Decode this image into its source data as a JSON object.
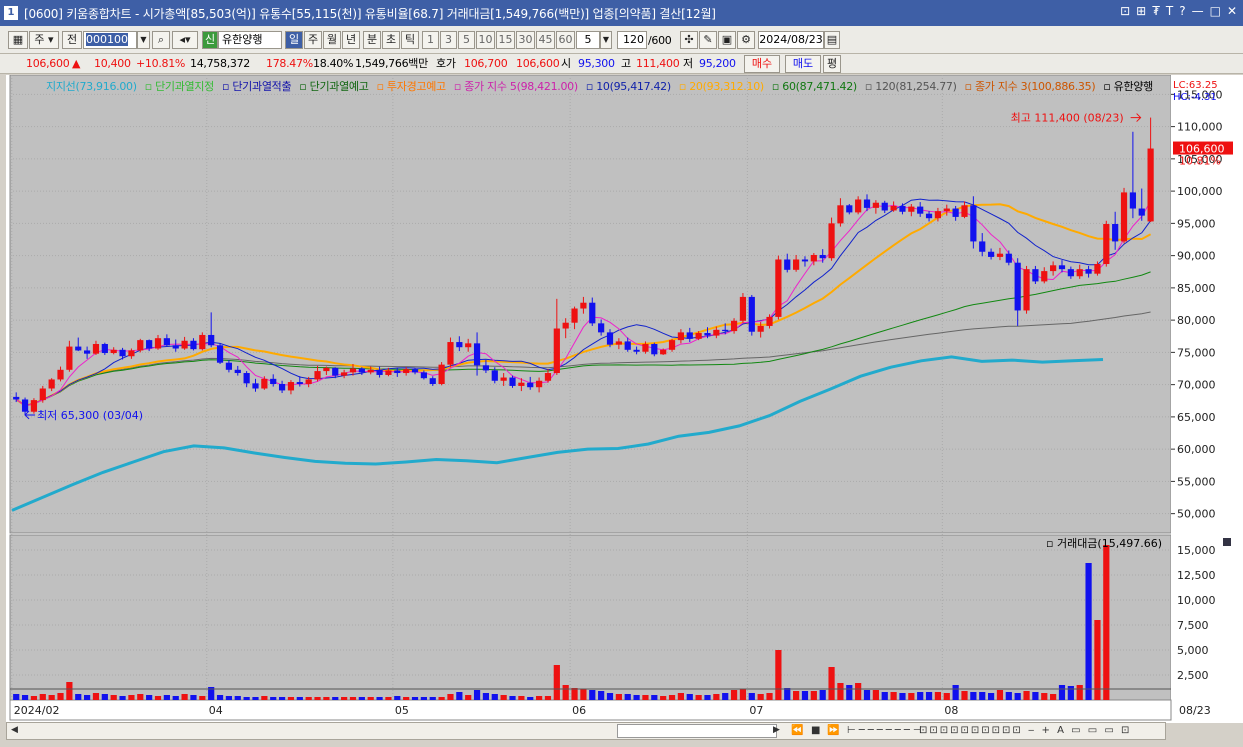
{
  "window": {
    "number": "1",
    "title": "[0600] 키움종합차트 - 시가총액[85,503(억)] 유통수[55,115(천)] 유통비율[68.7] 거래대금[1,549,766(백만)] 업종[의약품] 결산[12월]",
    "controls": [
      "⊡",
      "⊞",
      "₮",
      "T",
      "?",
      "—",
      "□",
      "✕"
    ]
  },
  "toolbar": {
    "period_unit": "주",
    "scope": "전",
    "code": "000100",
    "name_tag": "신",
    "stock_name": "유한양행",
    "intervals": [
      "일",
      "주",
      "월",
      "년",
      "분",
      "초",
      "틱"
    ],
    "selected_interval": "일",
    "minute_options": [
      "1",
      "3",
      "5",
      "10",
      "15",
      "30",
      "45",
      "60"
    ],
    "custom_interval": "5",
    "bars": "120",
    "bars_total": "/600",
    "date": "2024/08/23"
  },
  "quote": {
    "price": "106,600",
    "change": "10,400",
    "pct": "+10.81%",
    "volume": "14,758,372",
    "vol_ratio": "178.47%",
    "turnover": "18.40%",
    "amount": "1,549,766백만",
    "bid_label": "호가",
    "ask": "106,700",
    "bid": "106,600",
    "open_label": "시",
    "open": "95,300",
    "high_label": "고",
    "high": "111,400",
    "low_label": "저",
    "low": "95,200",
    "buy": "매수",
    "sell": "매도",
    "eval": "평"
  },
  "legend": [
    {
      "text": "지지선(73,916.00)",
      "color": "#22aacc"
    },
    {
      "text": "단기과열지정",
      "color": "#33bb33"
    },
    {
      "text": "단기과열적출",
      "color": "#1111aa"
    },
    {
      "text": "단기과열예고",
      "color": "#116611"
    },
    {
      "text": "투자경고예고",
      "color": "#ff7700"
    },
    {
      "text": "종가 지수 5(98,421.00)",
      "color": "#cc22aa"
    },
    {
      "text": "10(95,417.42)",
      "color": "#1122aa"
    },
    {
      "text": "20(93,312.10)",
      "color": "#ffaa00"
    },
    {
      "text": "60(87,471.42)",
      "color": "#117711"
    },
    {
      "text": "120(81,254.77)",
      "color": "#555555"
    },
    {
      "text": "종가 지수 3(100,886.35)",
      "color": "#cc5500"
    },
    {
      "text": "유한양행",
      "color": "#000000"
    }
  ],
  "right_labels": {
    "lc": "LC:63.25",
    "hc": "HC:-4.31",
    "current": "106,600",
    "pct": "10.81%"
  },
  "annotations": {
    "high": "최고 111,400 (08/23)",
    "low": "최저 65,300 (03/04)"
  },
  "volume_panel": {
    "title": "거래대금(15,497.66)"
  },
  "x_date_labels": [
    "2024/02",
    "04",
    "05",
    "06",
    "07",
    "08"
  ],
  "x_end_label": "08/23",
  "colors": {
    "up": "#ee1111",
    "down": "#1111ee",
    "ma5": "#ee22cc",
    "ma10": "#1122cc",
    "ma20": "#ffaa00",
    "ma60": "#118811",
    "ma120": "#666666",
    "support": "#22aacc",
    "bg": "#c0c0c0"
  },
  "chart_data": {
    "type": "candlestick",
    "ylim": [
      47000,
      118000
    ],
    "y_ticks": [
      115000,
      110000,
      105000,
      100000,
      95000,
      90000,
      85000,
      80000,
      75000,
      70000,
      65000,
      60000,
      55000,
      50000
    ],
    "y_tick_labels": [
      "115,000",
      "110,000",
      "105,000",
      "100,000",
      "95,000",
      "90,000",
      "85,000",
      "80,000",
      "75,000",
      "70,000",
      "65,000",
      "60,000",
      "55,000",
      "50,000"
    ],
    "x_ticks": [
      {
        "label": "2024/02",
        "index": 0
      },
      {
        "label": "04",
        "index": 22
      },
      {
        "label": "05",
        "index": 43
      },
      {
        "label": "06",
        "index": 63
      },
      {
        "label": "07",
        "index": 83
      },
      {
        "label": "08",
        "index": 105
      }
    ],
    "candles": [
      [
        68100,
        68800,
        67300,
        67700
      ],
      [
        67700,
        68000,
        65300,
        65800
      ],
      [
        65800,
        67900,
        65500,
        67600
      ],
      [
        67600,
        69800,
        67200,
        69400
      ],
      [
        69400,
        71000,
        69000,
        70800
      ],
      [
        70800,
        72800,
        70500,
        72300
      ],
      [
        72300,
        76800,
        72000,
        75900
      ],
      [
        75900,
        77300,
        75200,
        75300
      ],
      [
        75300,
        75900,
        74000,
        74800
      ],
      [
        74800,
        76800,
        74600,
        76300
      ],
      [
        76300,
        76500,
        74600,
        74900
      ],
      [
        74900,
        75800,
        74700,
        75400
      ],
      [
        75400,
        75700,
        73900,
        74400
      ],
      [
        74400,
        75600,
        74000,
        75300
      ],
      [
        75300,
        77100,
        75000,
        76900
      ],
      [
        76900,
        77000,
        75200,
        75600
      ],
      [
        75600,
        77700,
        75400,
        77200
      ],
      [
        77200,
        77800,
        75900,
        76100
      ],
      [
        76100,
        77000,
        75100,
        75600
      ],
      [
        75600,
        77400,
        75400,
        76800
      ],
      [
        76800,
        77200,
        75300,
        75500
      ],
      [
        75500,
        78100,
        75300,
        77700
      ],
      [
        77700,
        81200,
        75800,
        76100
      ],
      [
        76100,
        76400,
        73200,
        73400
      ],
      [
        73400,
        73800,
        71900,
        72300
      ],
      [
        72300,
        72900,
        71400,
        71800
      ],
      [
        71800,
        72100,
        69600,
        70200
      ],
      [
        70200,
        70900,
        68900,
        69400
      ],
      [
        69400,
        71300,
        69200,
        70900
      ],
      [
        70900,
        71600,
        69700,
        70100
      ],
      [
        70100,
        70600,
        68700,
        69100
      ],
      [
        69100,
        70700,
        68500,
        70400
      ],
      [
        70400,
        71300,
        69700,
        70100
      ],
      [
        70100,
        71200,
        69600,
        70800
      ],
      [
        70800,
        72900,
        70500,
        72100
      ],
      [
        72100,
        72800,
        71500,
        72600
      ],
      [
        72600,
        72700,
        71000,
        71400
      ],
      [
        71400,
        72300,
        71000,
        71900
      ],
      [
        71900,
        73200,
        71400,
        72500
      ],
      [
        72500,
        72700,
        71500,
        71900
      ],
      [
        71900,
        72800,
        71600,
        72300
      ],
      [
        72300,
        72800,
        71100,
        71500
      ],
      [
        71500,
        72600,
        71300,
        72200
      ],
      [
        72200,
        72500,
        71200,
        71800
      ],
      [
        71800,
        72700,
        71400,
        72400
      ],
      [
        72400,
        72600,
        71600,
        71900
      ],
      [
        71900,
        72200,
        70800,
        71000
      ],
      [
        71000,
        71300,
        69800,
        70100
      ],
      [
        70100,
        73500,
        69900,
        73100
      ],
      [
        73100,
        77300,
        72700,
        76600
      ],
      [
        76600,
        77500,
        75200,
        75800
      ],
      [
        75800,
        77100,
        75100,
        76400
      ],
      [
        76400,
        78100,
        71400,
        73000
      ],
      [
        73000,
        73800,
        71800,
        72200
      ],
      [
        72200,
        72700,
        70200,
        70600
      ],
      [
        70600,
        71800,
        69800,
        71100
      ],
      [
        71100,
        71400,
        69500,
        69800
      ],
      [
        69800,
        71000,
        69000,
        70300
      ],
      [
        70300,
        71200,
        69200,
        69600
      ],
      [
        69600,
        71100,
        68800,
        70600
      ],
      [
        70600,
        72400,
        70300,
        71800
      ],
      [
        71800,
        83300,
        71500,
        78700
      ],
      [
        78700,
        80300,
        77200,
        79600
      ],
      [
        79600,
        82100,
        78600,
        81800
      ],
      [
        81800,
        83600,
        81000,
        82700
      ],
      [
        82700,
        83500,
        79100,
        79500
      ],
      [
        79500,
        80100,
        77600,
        78100
      ],
      [
        78100,
        78600,
        75800,
        76200
      ],
      [
        76200,
        77200,
        75500,
        76700
      ],
      [
        76700,
        77300,
        75100,
        75400
      ],
      [
        75400,
        75900,
        74700,
        75100
      ],
      [
        75100,
        76700,
        74800,
        76300
      ],
      [
        76300,
        76500,
        74400,
        74700
      ],
      [
        74700,
        75600,
        74600,
        75400
      ],
      [
        75400,
        77100,
        75100,
        76900
      ],
      [
        76900,
        78600,
        76400,
        78100
      ],
      [
        78100,
        78800,
        76600,
        77100
      ],
      [
        77100,
        78300,
        76900,
        78000
      ],
      [
        78000,
        78900,
        77200,
        77600
      ],
      [
        77600,
        79000,
        77200,
        78500
      ],
      [
        78500,
        79500,
        77800,
        78300
      ],
      [
        78300,
        80300,
        77900,
        79900
      ],
      [
        79900,
        84200,
        79600,
        83600
      ],
      [
        83600,
        83900,
        77600,
        78200
      ],
      [
        78200,
        79700,
        77300,
        79100
      ],
      [
        79100,
        80900,
        78700,
        80500
      ],
      [
        80500,
        90000,
        80100,
        89400
      ],
      [
        89400,
        90300,
        87400,
        87800
      ],
      [
        87800,
        90100,
        87500,
        89400
      ],
      [
        89400,
        89900,
        88300,
        89100
      ],
      [
        89100,
        90400,
        88500,
        90100
      ],
      [
        90100,
        91000,
        88900,
        89600
      ],
      [
        89600,
        95900,
        89200,
        95000
      ],
      [
        95000,
        98900,
        94500,
        97800
      ],
      [
        97800,
        98000,
        96400,
        96700
      ],
      [
        96700,
        99200,
        96400,
        98700
      ],
      [
        98700,
        99500,
        96900,
        97400
      ],
      [
        97400,
        98600,
        96500,
        98200
      ],
      [
        98200,
        98500,
        96600,
        97000
      ],
      [
        97000,
        98400,
        96800,
        97700
      ],
      [
        97700,
        98100,
        96400,
        96800
      ],
      [
        96800,
        98000,
        96100,
        97600
      ],
      [
        97600,
        98300,
        96000,
        96500
      ],
      [
        96500,
        96900,
        95300,
        95800
      ],
      [
        95800,
        97400,
        95300,
        96900
      ],
      [
        96900,
        97900,
        96200,
        97300
      ],
      [
        97300,
        97700,
        95400,
        96000
      ],
      [
        96000,
        98400,
        95800,
        97800
      ],
      [
        97800,
        99200,
        91100,
        92200
      ],
      [
        92200,
        93500,
        89900,
        90600
      ],
      [
        90600,
        91100,
        89400,
        89800
      ],
      [
        89800,
        91200,
        89300,
        90300
      ],
      [
        90300,
        90800,
        88500,
        88900
      ],
      [
        88900,
        89600,
        79100,
        81500
      ],
      [
        81500,
        88400,
        81000,
        87900
      ],
      [
        87900,
        88400,
        85600,
        86000
      ],
      [
        86000,
        88200,
        85700,
        87600
      ],
      [
        87600,
        89100,
        86900,
        88500
      ],
      [
        88500,
        89300,
        87400,
        87900
      ],
      [
        87900,
        88300,
        86400,
        86800
      ],
      [
        86800,
        88600,
        86400,
        87900
      ],
      [
        87900,
        88400,
        86600,
        87200
      ],
      [
        87200,
        89100,
        86900,
        88700
      ],
      [
        88700,
        95400,
        88300,
        94900
      ],
      [
        94900,
        96800,
        90900,
        92200
      ],
      [
        92200,
        100500,
        91900,
        99800
      ],
      [
        99800,
        109200,
        95800,
        97300
      ],
      [
        97300,
        100400,
        95400,
        96200
      ],
      [
        95300,
        111400,
        95200,
        106600
      ]
    ],
    "ma5_last": 98421.0,
    "ma10_last": 95417.42,
    "ma20_last": 93312.1,
    "ma60_last": 87471.42,
    "ma120_last": 81254.77,
    "support_line": [
      50500,
      52500,
      54500,
      56400,
      58000,
      59600,
      60500,
      60200,
      59400,
      58700,
      58100,
      57800,
      57700,
      58000,
      58400,
      58200,
      57900,
      58700,
      59500,
      60000,
      60100,
      60800,
      62000,
      62600,
      63600,
      65200,
      67400,
      69300,
      71300,
      72700,
      73700,
      74300,
      73600,
      73800,
      73500,
      73700,
      73900
    ],
    "volume": {
      "ylim": [
        0,
        16500
      ],
      "y_ticks": [
        2500,
        5000,
        7500,
        10000,
        12500,
        15000
      ],
      "y_tick_labels": [
        "2,500",
        "5,000",
        "7,500",
        "10,000",
        "12,500",
        "15,000"
      ],
      "values": [
        600,
        500,
        400,
        600,
        500,
        700,
        1800,
        600,
        500,
        700,
        600,
        500,
        400,
        500,
        600,
        500,
        400,
        500,
        400,
        600,
        500,
        400,
        1300,
        500,
        400,
        400,
        300,
        300,
        400,
        300,
        300,
        300,
        300,
        300,
        300,
        300,
        300,
        300,
        300,
        300,
        300,
        300,
        300,
        400,
        300,
        300,
        300,
        300,
        300,
        600,
        800,
        500,
        1000,
        700,
        600,
        500,
        400,
        400,
        300,
        400,
        400,
        3500,
        1500,
        1200,
        1100,
        1000,
        900,
        700,
        600,
        600,
        500,
        500,
        500,
        400,
        500,
        700,
        600,
        500,
        500,
        600,
        700,
        1000,
        1100,
        700,
        600,
        700,
        5000,
        1200,
        900,
        900,
        900,
        1000,
        3300,
        1700,
        1500,
        1700,
        1000,
        1000,
        800,
        800,
        700,
        700,
        800,
        800,
        800,
        700,
        1500,
        900,
        800,
        800,
        700,
        1000,
        800,
        700,
        900,
        800,
        700,
        600,
        1500,
        1400,
        1500,
        13700,
        8000,
        15500
      ],
      "avg": 1100
    }
  }
}
